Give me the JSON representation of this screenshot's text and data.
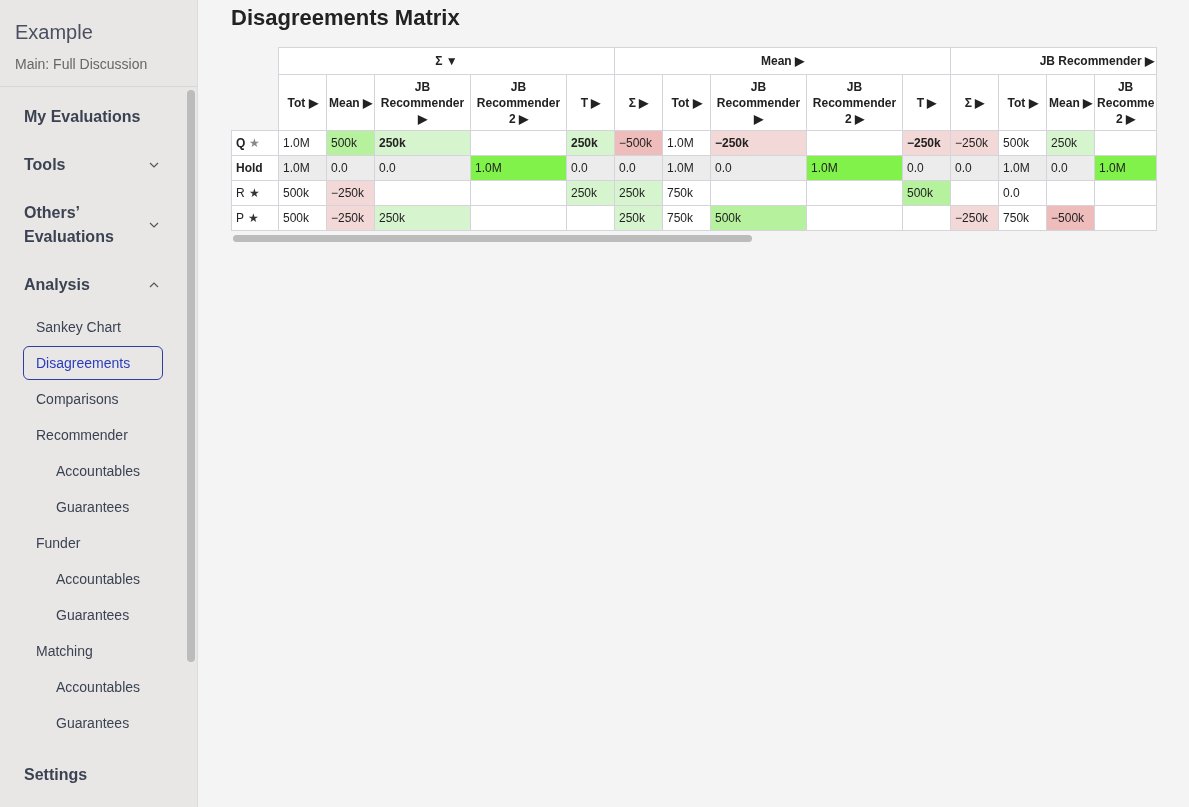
{
  "sidebar": {
    "title": "Example",
    "subtitle": "Main: Full Discussion",
    "items": [
      {
        "label": "My Evaluations",
        "selected": false
      },
      {
        "label": "Tools",
        "expanded": false,
        "selected": false
      },
      {
        "label": "Others’ Evaluations",
        "expanded": false,
        "selected": false
      },
      {
        "label": "Analysis",
        "expanded": true,
        "selected": false,
        "children": [
          {
            "label": "Sankey Chart",
            "selected": false
          },
          {
            "label": "Disagreements",
            "selected": true
          },
          {
            "label": "Comparisons",
            "selected": false
          },
          {
            "label": "Recommender",
            "selected": false,
            "children": [
              {
                "label": "Accountables",
                "selected": false
              },
              {
                "label": "Guarantees",
                "selected": false
              }
            ]
          },
          {
            "label": "Funder",
            "selected": false,
            "children": [
              {
                "label": "Accountables",
                "selected": false
              },
              {
                "label": "Guarantees",
                "selected": false
              }
            ]
          },
          {
            "label": "Matching",
            "selected": false,
            "children": [
              {
                "label": "Accountables",
                "selected": false
              },
              {
                "label": "Guarantees",
                "selected": false
              }
            ]
          }
        ]
      },
      {
        "label": "Settings",
        "selected": false
      }
    ]
  },
  "page_title": "Disagreements Matrix",
  "table": {
    "groups": [
      {
        "label": "Σ ▼"
      },
      {
        "label": "Mean ▶"
      },
      {
        "label": "JB Recommender ▶"
      }
    ],
    "columns": [
      {
        "label": "Tot ▶",
        "kind": "narrow"
      },
      {
        "label": "Mean ▶",
        "kind": "narrow"
      },
      {
        "label": "JB Recommender ▶",
        "kind": "wide"
      },
      {
        "label": "JB Recommender 2 ▶",
        "kind": "wide"
      },
      {
        "label": "T ▶",
        "kind": "narrow"
      },
      {
        "label": "Σ ▶",
        "kind": "narrow"
      },
      {
        "label": "Tot ▶",
        "kind": "narrow"
      },
      {
        "label": "JB Recommender ▶",
        "kind": "wide"
      },
      {
        "label": "JB Recommender 2 ▶",
        "kind": "wide"
      },
      {
        "label": "T ▶",
        "kind": "narrow"
      },
      {
        "label": "Σ ▶",
        "kind": "narrow"
      },
      {
        "label": "Tot ▶",
        "kind": "narrow"
      },
      {
        "label": "Mean ▶",
        "kind": "narrow"
      },
      {
        "label": "JB Recomme 2 ▶",
        "kind": "cut"
      }
    ],
    "rows": [
      {
        "label": "Q",
        "bold": true,
        "star": {
          "glyph": "★",
          "color": "#888888"
        },
        "shaded": false,
        "cells": [
          {
            "value": "1.0M",
            "bold": false
          },
          {
            "value": "500k",
            "color": "#b6f29d",
            "bold": false
          },
          {
            "value": "250k",
            "color": "#d6f5cf",
            "bold": true
          },
          {},
          {
            "value": "250k",
            "color": "#d6f5cf",
            "bold": true
          },
          {
            "value": "−500k",
            "color": "#efbcbc",
            "bold": false
          },
          {
            "value": "1.0M",
            "bold": false
          },
          {
            "value": "−250k",
            "color": "#f3d8d8",
            "bold": true
          },
          {},
          {
            "value": "−250k",
            "color": "#f3d8d8",
            "bold": true
          },
          {
            "value": "−250k",
            "color": "#f3d8d8",
            "bold": false
          },
          {
            "value": "500k",
            "bold": false
          },
          {
            "value": "250k",
            "color": "#d6f5cf",
            "bold": false
          },
          {}
        ]
      },
      {
        "label": "Hold",
        "bold": true,
        "shaded": true,
        "cells": [
          {
            "value": "1.0M"
          },
          {
            "value": "0.0"
          },
          {
            "value": "0.0"
          },
          {
            "value": "1.0M",
            "color": "#80f24a"
          },
          {
            "value": "0.0"
          },
          {
            "value": "0.0"
          },
          {
            "value": "1.0M"
          },
          {
            "value": "0.0"
          },
          {
            "value": "1.0M",
            "color": "#80f24a"
          },
          {
            "value": "0.0"
          },
          {
            "value": "0.0"
          },
          {
            "value": "1.0M"
          },
          {
            "value": "0.0"
          },
          {
            "value": "1.0M",
            "color": "#80f24a"
          }
        ]
      },
      {
        "label": "R",
        "bold": false,
        "star": {
          "glyph": "★",
          "color": "#333333"
        },
        "shaded": false,
        "cells": [
          {
            "value": "500k"
          },
          {
            "value": "−250k",
            "color": "#f3d8d8"
          },
          {},
          {},
          {
            "value": "250k",
            "color": "#d6f5cf"
          },
          {
            "value": "250k",
            "color": "#d6f5cf"
          },
          {
            "value": "750k"
          },
          {},
          {},
          {
            "value": "500k",
            "color": "#b6f29d"
          },
          {},
          {
            "value": "0.0"
          },
          {},
          {}
        ]
      },
      {
        "label": "P",
        "bold": false,
        "star": {
          "glyph": "★",
          "color": "#333333"
        },
        "shaded": false,
        "cells": [
          {
            "value": "500k"
          },
          {
            "value": "−250k",
            "color": "#f3d8d8"
          },
          {
            "value": "250k",
            "color": "#d6f5cf"
          },
          {},
          {},
          {
            "value": "250k",
            "color": "#d6f5cf"
          },
          {
            "value": "750k"
          },
          {
            "value": "500k",
            "color": "#b6f29d"
          },
          {},
          {},
          {
            "value": "−250k",
            "color": "#f3d8d8"
          },
          {
            "value": "750k"
          },
          {
            "value": "−500k",
            "color": "#efbcbc"
          },
          {}
        ]
      }
    ]
  }
}
